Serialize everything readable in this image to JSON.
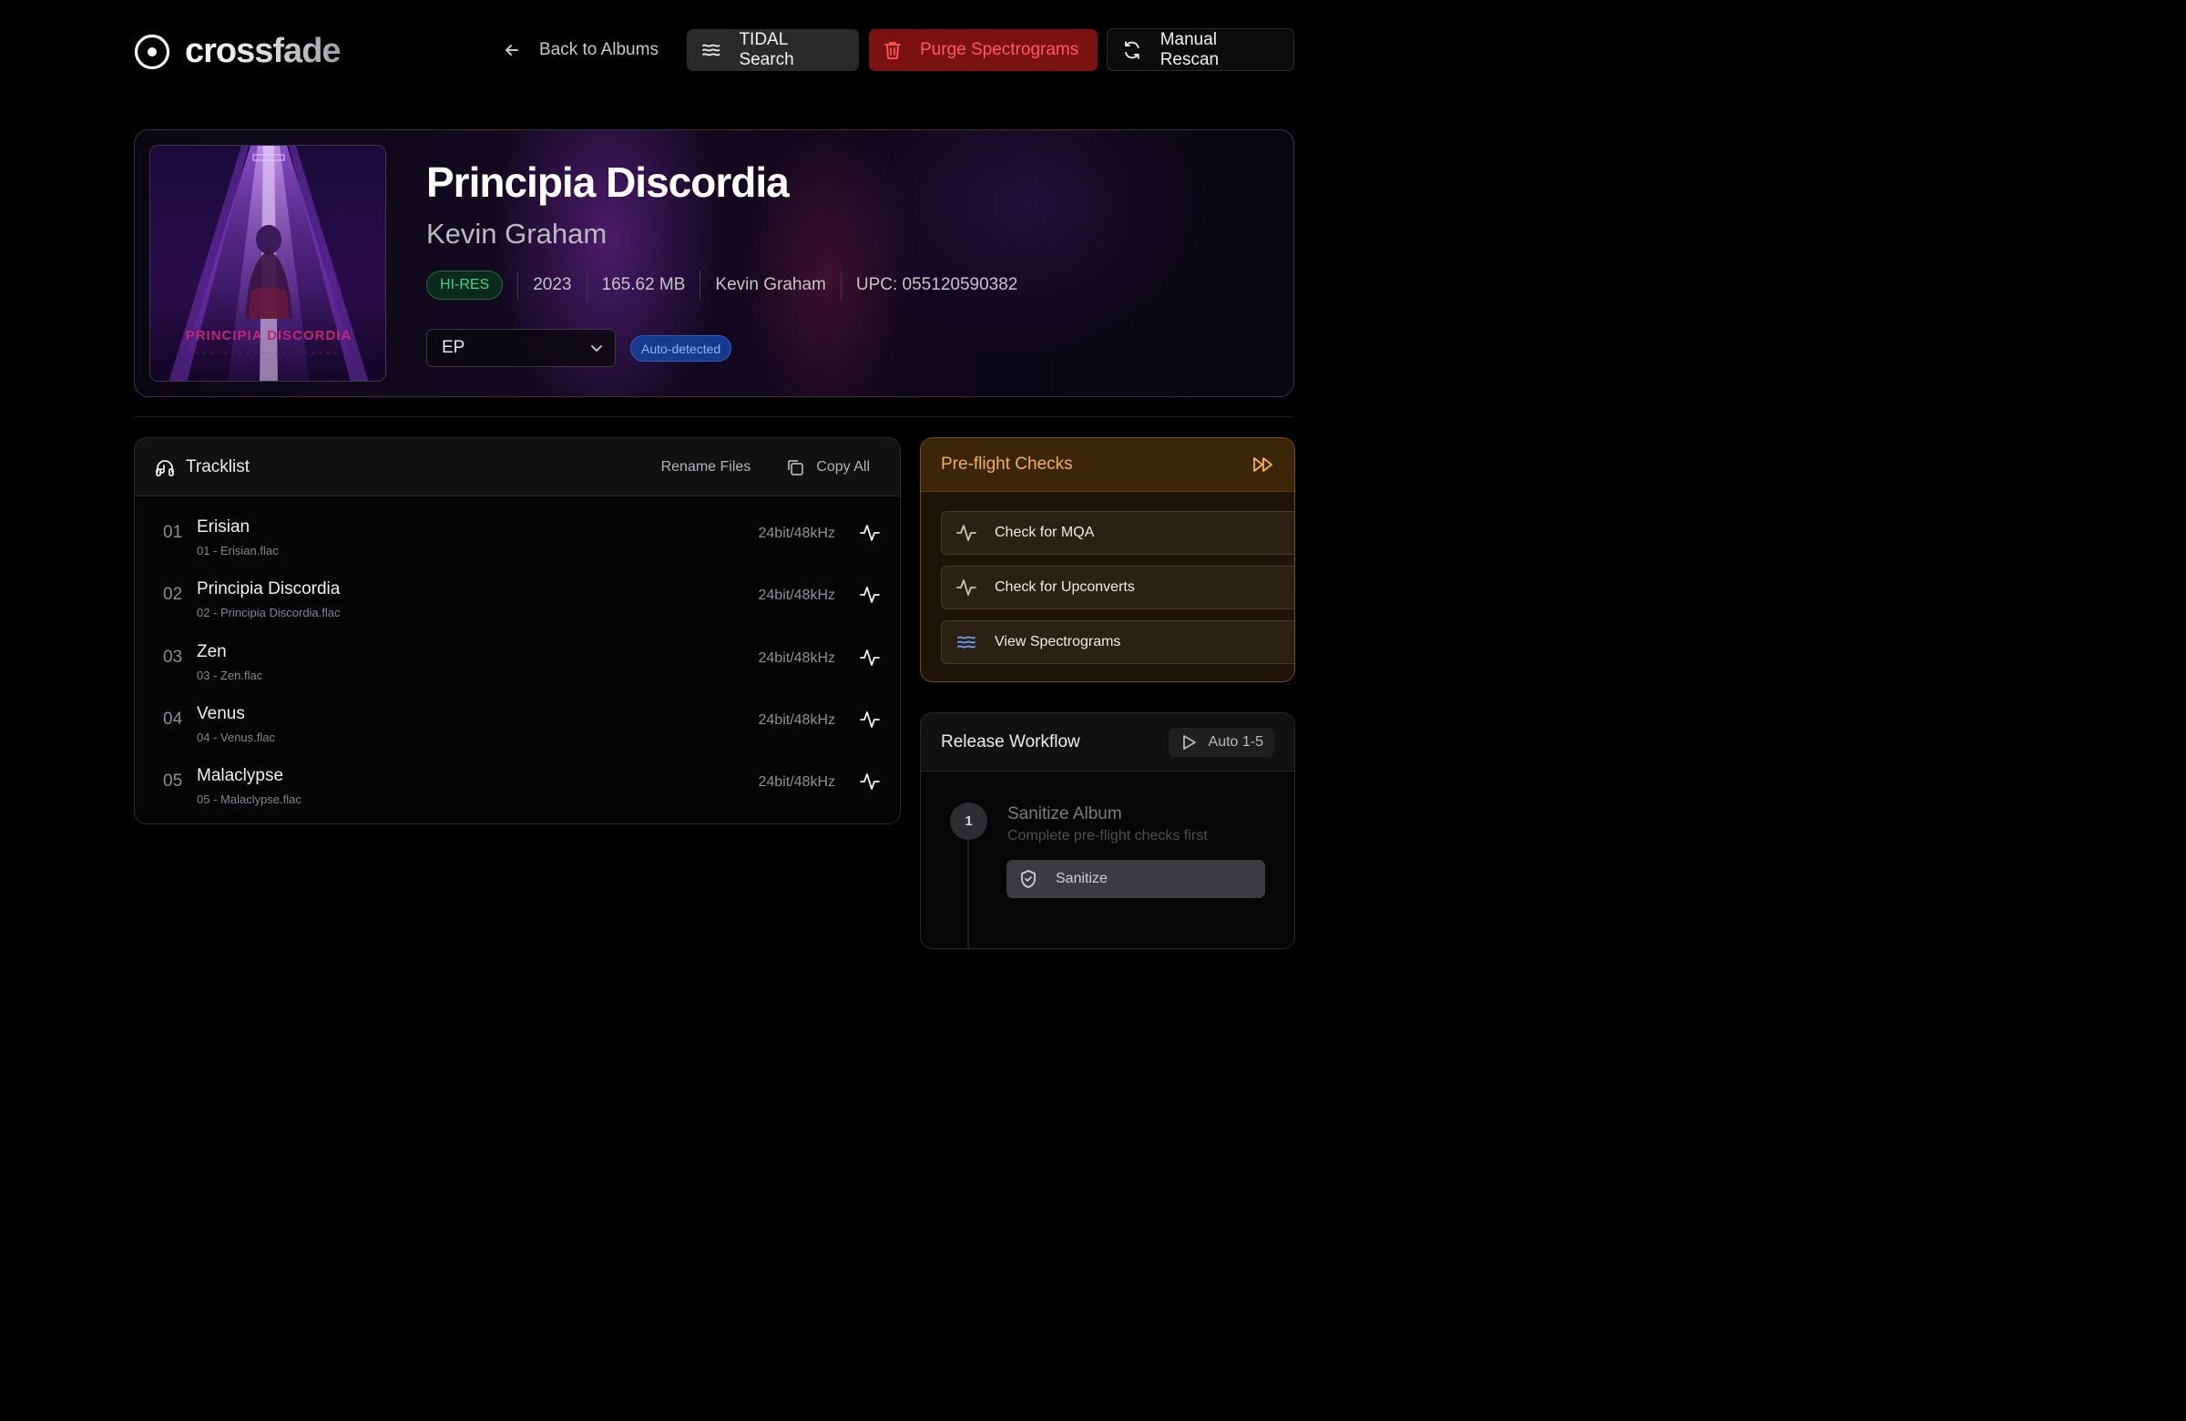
{
  "header": {
    "logo_text": "crossfade",
    "back_label": "Back to Albums",
    "tidal_label": "TIDAL Search",
    "purge_label": "Purge Spectrograms",
    "rescan_label": "Manual Rescan"
  },
  "album": {
    "title": "Principia Discordia",
    "artist": "Kevin Graham",
    "quality_badge": "HI-RES",
    "year": "2023",
    "size": "165.62 MB",
    "label_artist": "Kevin Graham",
    "upc": "UPC: 055120590382",
    "type_selected": "EP",
    "auto_badge": "Auto-detected",
    "cover_text": "PRINCIPIA DISCORDIA"
  },
  "tracklist": {
    "title": "Tracklist",
    "rename_label": "Rename Files",
    "copy_label": "Copy All",
    "tracks": [
      {
        "num": "01",
        "name": "Erisian",
        "file": "01 - Erisian.flac",
        "quality": "24bit/48kHz"
      },
      {
        "num": "02",
        "name": "Principia Discordia",
        "file": "02 - Principia Discordia.flac",
        "quality": "24bit/48kHz"
      },
      {
        "num": "03",
        "name": "Zen",
        "file": "03 - Zen.flac",
        "quality": "24bit/48kHz"
      },
      {
        "num": "04",
        "name": "Venus",
        "file": "04 - Venus.flac",
        "quality": "24bit/48kHz"
      },
      {
        "num": "05",
        "name": "Malaclypse",
        "file": "05 - Malaclypse.flac",
        "quality": "24bit/48kHz"
      }
    ]
  },
  "preflight": {
    "title": "Pre-flight Checks",
    "buttons": [
      {
        "label": "Check for MQA",
        "icon": "activity-icon"
      },
      {
        "label": "Check for Upconverts",
        "icon": "activity-icon"
      },
      {
        "label": "View Spectrograms",
        "icon": "waves-icon"
      }
    ]
  },
  "release": {
    "title": "Release Workflow",
    "auto_label": "Auto 1-5",
    "step_number": "1",
    "step_title": "Sanitize Album",
    "step_subtitle": "Complete pre-flight checks first",
    "sanitize_label": "Sanitize"
  },
  "colors": {
    "accent_red": "#7a1212",
    "accent_amber": "#f3b24e",
    "hires_green": "#37d883",
    "auto_blue": "#163a8c"
  }
}
